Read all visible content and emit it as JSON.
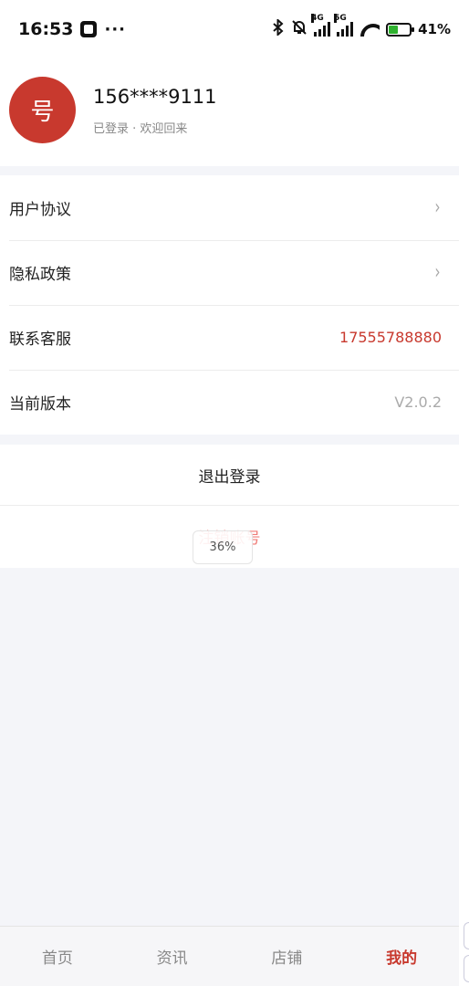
{
  "status_bar": {
    "time": "16:53",
    "more": "···",
    "net1": "4G",
    "net2": "5G",
    "battery_pct": "41%"
  },
  "profile": {
    "avatar_text": "号",
    "phone": "156****9111",
    "status": "已登录 · 欢迎回来"
  },
  "menu": {
    "items": [
      {
        "label": "用户协议",
        "chevron": "›"
      },
      {
        "label": "隐私政策",
        "chevron": "›"
      },
      {
        "label": "联系客服",
        "value": "17555788880"
      },
      {
        "label": "当前版本",
        "value": "V2.0.2"
      }
    ]
  },
  "actions": {
    "logout": "退出登录",
    "delete_account": "注销账号"
  },
  "toast": {
    "text": "36%"
  },
  "tabbar": {
    "tabs": [
      {
        "label": "首页"
      },
      {
        "label": "资讯"
      },
      {
        "label": "店铺"
      },
      {
        "label": "我的"
      }
    ]
  },
  "colors": {
    "brand": "#c8392e",
    "danger_light": "#f07e79",
    "page_bg": "#f4f5f9"
  }
}
